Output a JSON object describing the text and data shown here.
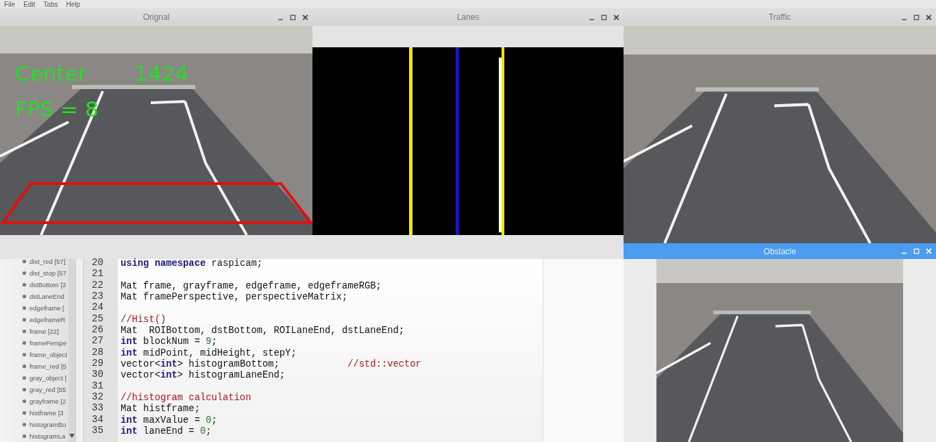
{
  "menu": [
    "File",
    "Edit",
    "Tabs",
    "Help"
  ],
  "windows": [
    {
      "title": "Orignal",
      "kind": "camera",
      "active": false,
      "roi_box": true,
      "overlay_lines": [
        [
          "Center",
          "1424"
        ],
        [
          "FPS = 8"
        ]
      ]
    },
    {
      "title": "Lanes",
      "kind": "lanes",
      "active": false
    },
    {
      "title": "Traffic",
      "kind": "camera",
      "active": false
    },
    {
      "title": "Obstacle",
      "kind": "camera",
      "active": true,
      "letterbox": true
    }
  ],
  "symbols": [
    "dist_red [57]",
    "dist_stop [57",
    "dstBottom [2",
    "dstLaneEnd",
    "edgeframe [",
    "edgeframeR",
    "frame [22]",
    "framePerspe",
    "frame_object",
    "frame_red [5",
    "gray_object [",
    "gray_red [55",
    "grayframe [2",
    "histframe [3",
    "histogramBo",
    "histogramLa"
  ],
  "code": [
    {
      "number": "20",
      "tokens": [
        {
          "kind": "kw",
          "text": "using namespace"
        },
        {
          "kind": "plain",
          "text": " raspicam;"
        }
      ]
    },
    {
      "number": "21"
    },
    {
      "number": "22",
      "tokens": [
        {
          "kind": "plain",
          "text": "Mat frame, grayframe, edgeframe, edgeframeRGB;"
        }
      ]
    },
    {
      "number": "23",
      "tokens": [
        {
          "kind": "plain",
          "text": "Mat framePerspective, perspectiveMatrix;"
        }
      ]
    },
    {
      "number": "24"
    },
    {
      "number": "25",
      "tokens": [
        {
          "kind": "comment",
          "text": "//Hist()"
        }
      ]
    },
    {
      "number": "26",
      "tokens": [
        {
          "kind": "plain",
          "text": "Mat  ROIBottom, dstBottom, ROILaneEnd, dstLaneEnd;"
        }
      ]
    },
    {
      "number": "27",
      "tokens": [
        {
          "kind": "kw",
          "text": "int"
        },
        {
          "kind": "plain",
          "text": " blockNum = "
        },
        {
          "kind": "num",
          "text": "9"
        },
        {
          "kind": "plain",
          "text": ";"
        }
      ]
    },
    {
      "number": "28",
      "tokens": [
        {
          "kind": "kw",
          "text": "int"
        },
        {
          "kind": "plain",
          "text": " midPoint, midHeight, stepY;"
        }
      ]
    },
    {
      "number": "29",
      "tokens": [
        {
          "kind": "plain",
          "text": "vector<"
        },
        {
          "kind": "kw",
          "text": "int"
        },
        {
          "kind": "plain",
          "text": "> histogramBottom;            "
        },
        {
          "kind": "comment",
          "text": "//std::vector"
        }
      ]
    },
    {
      "number": "30",
      "tokens": [
        {
          "kind": "plain",
          "text": "vector<"
        },
        {
          "kind": "kw",
          "text": "int"
        },
        {
          "kind": "plain",
          "text": "> histogramLaneEnd;"
        }
      ]
    },
    {
      "number": "31"
    },
    {
      "number": "32",
      "tokens": [
        {
          "kind": "comment",
          "text": "//histogram calculation"
        }
      ]
    },
    {
      "number": "33",
      "tokens": [
        {
          "kind": "plain",
          "text": "Mat histframe;"
        }
      ]
    },
    {
      "number": "34",
      "tokens": [
        {
          "kind": "kw",
          "text": "int"
        },
        {
          "kind": "plain",
          "text": " maxValue = "
        },
        {
          "kind": "num",
          "text": "0"
        },
        {
          "kind": "plain",
          "text": ";"
        }
      ]
    },
    {
      "number": "35",
      "tokens": [
        {
          "kind": "kw",
          "text": "int"
        },
        {
          "kind": "plain",
          "text": " laneEnd = "
        },
        {
          "kind": "num",
          "text": "0"
        },
        {
          "kind": "plain",
          "text": ";"
        }
      ]
    }
  ]
}
